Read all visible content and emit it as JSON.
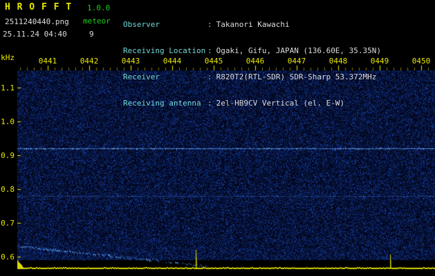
{
  "header": {
    "title": "H R O F F T",
    "version": "1.0.0",
    "filename": "2511240440.png",
    "mode": "meteor",
    "datetime": "25.11.24 04:40",
    "count": "9",
    "colon": ":",
    "info_rows": [
      {
        "label": "Observer",
        "value": "Takanori Kawachi"
      },
      {
        "label": "Receiving Location",
        "value": "Ogaki, Gifu, JAPAN (136.60E, 35.35N)"
      },
      {
        "label": "Receiver",
        "value": "R820T2(RTL-SDR) SDR-Sharp 53.372MHz"
      },
      {
        "label": "Receiving antenna",
        "value": "2el-HB9CV Vertical (el. E-W)"
      }
    ]
  },
  "spectrogram": {
    "y_axis": {
      "unit": "kHz",
      "ticks": [
        "1.1",
        "1.0",
        "0.9",
        "0.8",
        "0.7",
        "0.6"
      ]
    },
    "x_axis": {
      "ticks": [
        "0441",
        "0442",
        "0443",
        "0444",
        "0445",
        "0446",
        "0447",
        "0448",
        "0449",
        "0450"
      ]
    },
    "carrier_lines": [
      {
        "khz": 0.92,
        "strength": "strong"
      },
      {
        "khz": 0.78,
        "strength": "faint"
      }
    ],
    "descending_trace": {
      "start_frac": 0.0,
      "end_frac": 0.455,
      "start_khz": 0.632,
      "end_khz": 0.573
    },
    "colors": {
      "axis_label": "#e8e800",
      "noise_base": "#000016"
    }
  },
  "level_graph": {
    "baseline_color": "#d8d800",
    "spikes": [
      {
        "pos": 0.427,
        "height": 27
      },
      {
        "pos": 0.892,
        "height": 20
      }
    ]
  }
}
